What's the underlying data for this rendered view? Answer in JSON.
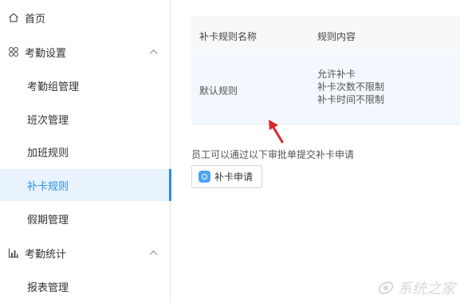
{
  "sidebar": {
    "items": [
      {
        "label": "首页",
        "icon": "home-icon"
      },
      {
        "label": "考勤设置",
        "icon": "settings-grid-icon"
      },
      {
        "label": "考勤组管理"
      },
      {
        "label": "班次管理"
      },
      {
        "label": "加班规则"
      },
      {
        "label": "补卡规则"
      },
      {
        "label": "假期管理"
      },
      {
        "label": "考勤统计",
        "icon": "bar-chart-icon"
      },
      {
        "label": "报表管理"
      }
    ],
    "active_item": "补卡规则",
    "accent_color": "#2b8ee8"
  },
  "table": {
    "headers": [
      "补卡规则名称",
      "规则内容"
    ],
    "rows": [
      {
        "name": "默认规则",
        "content": [
          "允许补卡",
          "补卡次数不限制",
          "补卡时间不限制"
        ]
      }
    ]
  },
  "tip": "员工可以通过以下审批单提交补卡申请",
  "apply_button": {
    "label": "补卡申请",
    "icon": "form-app-icon"
  },
  "watermark": "系统之家"
}
